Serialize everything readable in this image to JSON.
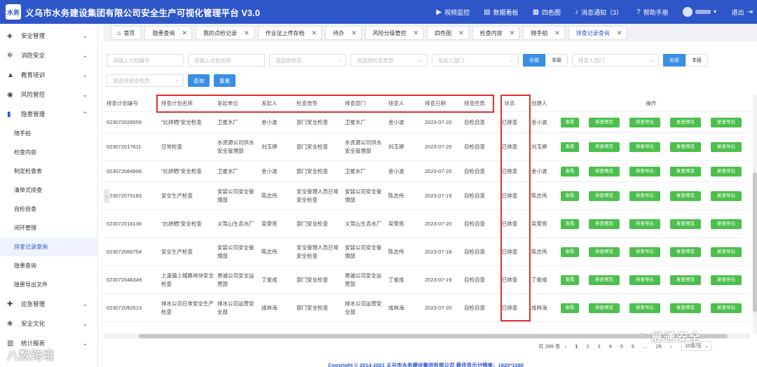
{
  "header": {
    "logo_text": "水务",
    "title": "义乌市水务建设集团有限公司安全生产可视化管理平台 V3.0",
    "nav": [
      {
        "icon": "video-icon",
        "label": "视频监控"
      },
      {
        "icon": "dashboard-icon",
        "label": "数据看板"
      },
      {
        "icon": "grid-icon",
        "label": "四色图"
      },
      {
        "icon": "bell-icon",
        "label": "消息通知（3）"
      },
      {
        "icon": "help-icon",
        "label": "帮助手册"
      }
    ],
    "logout": "退出"
  },
  "sidebar": {
    "groups": [
      {
        "icon": "shield-icon",
        "label": "安全管理"
      },
      {
        "icon": "fire-icon",
        "label": "消防安全"
      },
      {
        "icon": "graduation-icon",
        "label": "教育培训"
      },
      {
        "icon": "risk-icon",
        "label": "风险管控"
      },
      {
        "icon": "hazard-icon",
        "label": "隐患管理"
      }
    ],
    "sub_items": [
      "随手拍",
      "检查内容",
      "制定检查表",
      "清单式排查",
      "自检自查",
      "闭环管理",
      "排查记录查询",
      "隐患查询",
      "隐患导出文件"
    ],
    "groups_after": [
      {
        "icon": "emergency-icon",
        "label": "应急管理"
      },
      {
        "icon": "culture-icon",
        "label": "安全文化"
      },
      {
        "icon": "report-icon",
        "label": "统计报表"
      }
    ],
    "watermark": "八数跨境"
  },
  "tabs": [
    {
      "label": "首页"
    },
    {
      "label": "隐患查询"
    },
    {
      "label": "我的点检记录"
    },
    {
      "label": "作业证上传存档"
    },
    {
      "label": "待办"
    },
    {
      "label": "风险分级管控"
    },
    {
      "label": "四色图"
    },
    {
      "label": "检查内容"
    },
    {
      "label": "随手拍"
    },
    {
      "label": "排查记录查询"
    }
  ],
  "filters": {
    "row1": [
      "请输入计划编号",
      "请输入计划名称",
      "请选择状态",
      "请选择检查类型",
      "发起人部门"
    ],
    "seg_all": "全部",
    "seg_level": "本级",
    "row1_right": "排查人部门",
    "row2_select": "请选择排查性质",
    "query": "查询",
    "reset": "重置"
  },
  "table": {
    "headers": [
      "排查计划编号",
      "排查计划名称",
      "发起单位",
      "发起人",
      "检查类型",
      "排查部门",
      "排查人",
      "排查日期",
      "排查性质",
      "状态",
      "创建人",
      "操作"
    ],
    "actions": [
      "查看",
      "排查预览",
      "排查导出",
      "复查预览",
      "复查导出"
    ],
    "rows": [
      {
        "id": "023072026559",
        "name": "\"比拼晒\"安全检查",
        "unit": "卫星水厂",
        "initiator": "金小波",
        "type": "部门安全检查",
        "dept": "卫星水厂",
        "inspector": "金小波",
        "date": "2023-07-20",
        "nature": "自检自查",
        "status": "已排查",
        "creator": "金小波"
      },
      {
        "id": "023072017611",
        "name": "日常检查",
        "unit": "水资源公司供水安全管理部",
        "initiator": "刘玉婷",
        "type": "部门安全检查",
        "dept": "水资源公司供水安全管理部",
        "inspector": "刘玉婷",
        "date": "2023-07-20",
        "nature": "自检自查",
        "status": "已排查",
        "creator": "刘玉婷"
      },
      {
        "id": "023072064906",
        "name": "\"比拼晒\"安全检查",
        "unit": "卫星水厂",
        "initiator": "金小波",
        "type": "部门安全检查",
        "dept": "卫星水厂",
        "inspector": "金小波",
        "date": "2023-07-20",
        "nature": "自检自查",
        "status": "已排查",
        "creator": "金小波"
      },
      {
        "id": "023072075183",
        "name": "安全生产检查",
        "unit": "安装公司安全管理部",
        "initiator": "陈志伟",
        "type": "安全管理人员日常安全检查",
        "dept": "安装公司安全管理部",
        "inspector": "陈志伟",
        "date": "2023-07-19",
        "nature": "自检自查",
        "status": "已排查",
        "creator": "陈志伟"
      },
      {
        "id": "023072018136",
        "name": "\"比拼晒\"安全检查",
        "unit": "义驾山生态水厂",
        "initiator": "吴荣亮",
        "type": "部门安全检查",
        "dept": "义驾山生态水厂",
        "inspector": "吴荣亮",
        "date": "2023-07-20",
        "nature": "自检自查",
        "status": "已排查",
        "creator": "吴荣亮"
      },
      {
        "id": "023072066754",
        "name": "安全生产检查",
        "unit": "安装公司安全管理部",
        "initiator": "陈志伟",
        "type": "安全管理人员日常安全检查",
        "dept": "安装公司安全管理部",
        "inspector": "陈志伟",
        "date": "2023-07-18",
        "nature": "自检自查",
        "status": "已排查",
        "creator": "陈志伟"
      },
      {
        "id": "023072046349",
        "name": "上溪镇上城路地块安全检查",
        "unit": "易诚公司安全运营部",
        "initiator": "丁俊成",
        "type": "部门安全检查",
        "dept": "易诚公司安全运营部",
        "inspector": "丁俊成",
        "date": "2023-07-19",
        "nature": "自检自查",
        "status": "已排查",
        "creator": "丁俊成"
      },
      {
        "id": "023072092513",
        "name": "排水公司日常安全生产检查",
        "unit": "排水公司运营安全部",
        "initiator": "成林海",
        "type": "部门安全检查",
        "dept": "排水公司运营安全部",
        "inspector": "成林海",
        "date": "2023-07-20",
        "nature": "自检自查",
        "status": "已排查",
        "creator": "成林海"
      }
    ]
  },
  "pager": {
    "total": "共 289 条",
    "pages": [
      "1",
      "2",
      "3",
      "4",
      "5",
      "6",
      "...",
      "29"
    ],
    "current": "1",
    "size": "10条/页"
  },
  "footer": "Copyright © 2014-2021 义乌市水务建设集团有限公司 最佳显示分辨率：1920*1080",
  "watermark2": "展通安全",
  "colors": {
    "header": "#2e56c9",
    "primary": "#3a8ee6",
    "action": "#4cbf4c",
    "highlight": "#e02f2f"
  }
}
